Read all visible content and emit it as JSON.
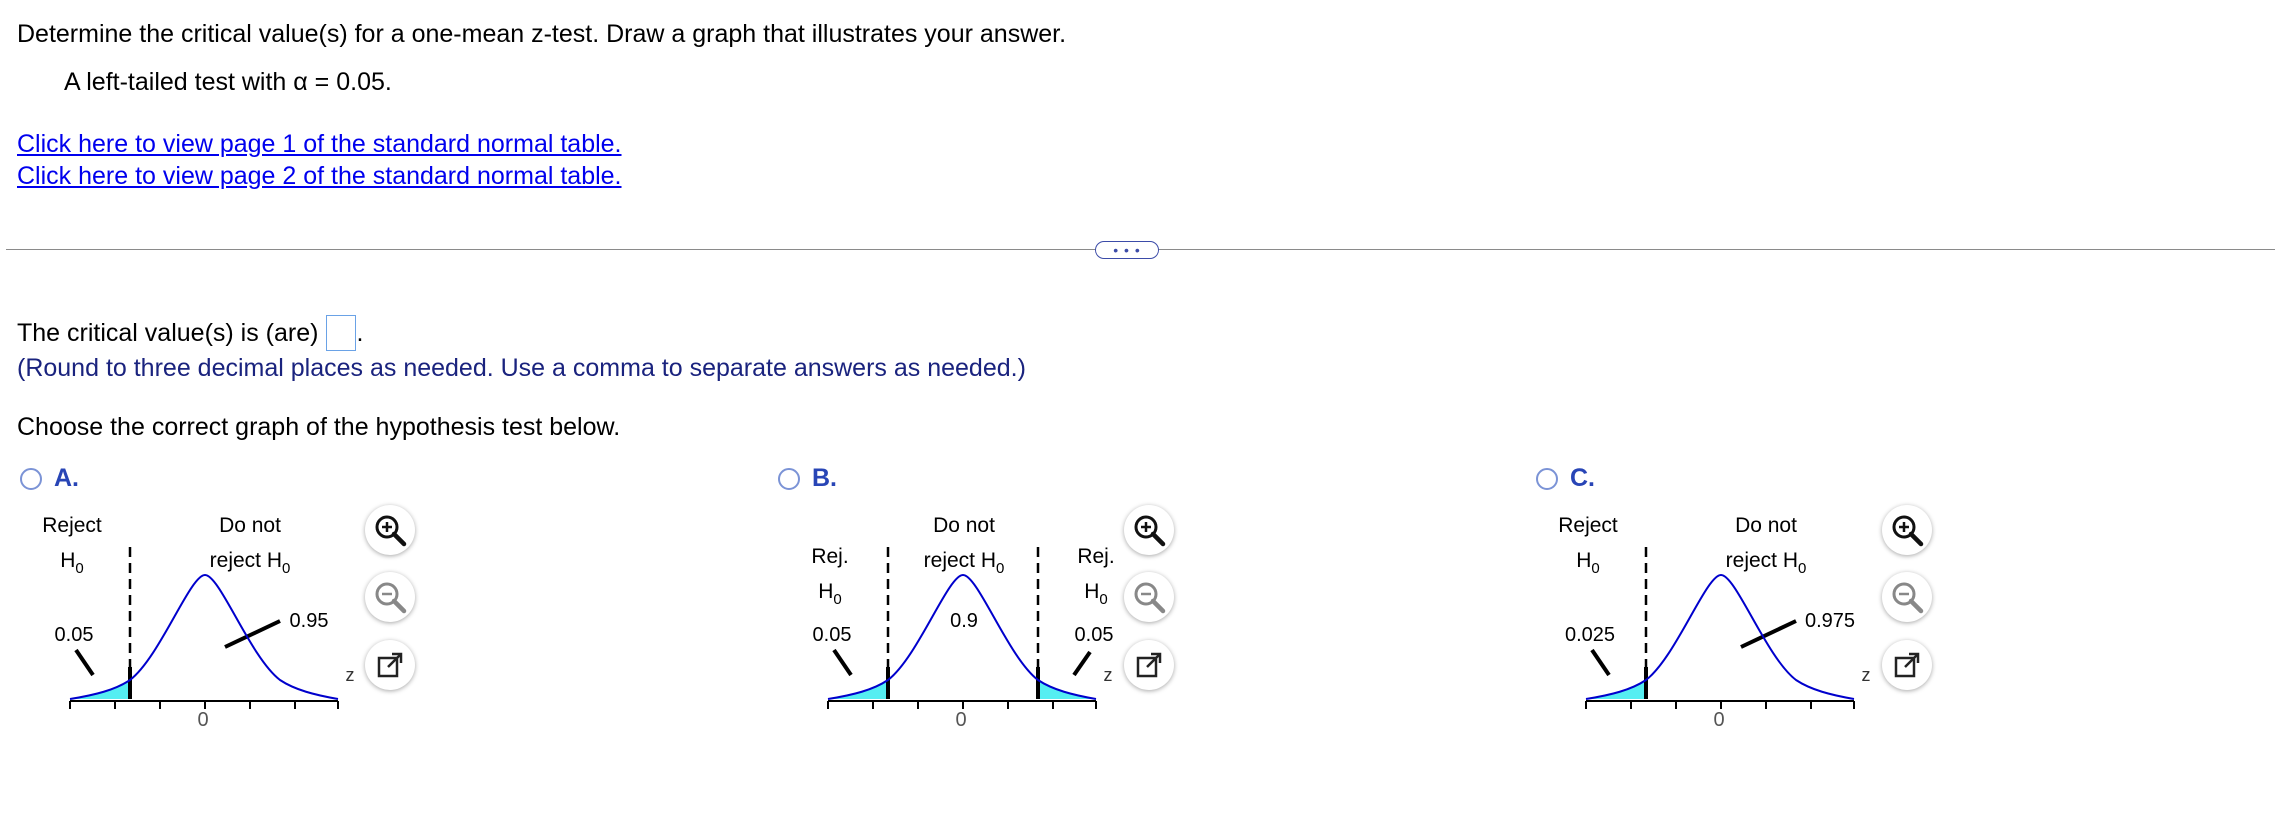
{
  "question": {
    "prompt": "Determine the critical value(s) for a one-mean z-test. Draw a graph that illustrates your answer.",
    "condition_prefix": "A left-tailed test with ",
    "condition_alpha": "α = 0.05."
  },
  "links": [
    "Click here to view page 1 of the standard normal table.",
    "Click here to view page 2 of the standard normal table."
  ],
  "more_button_label": "• • •",
  "answer": {
    "prompt_before": "The critical value(s) is (are)",
    "prompt_after": ".",
    "value": "",
    "note": "(Round to three decimal places as needed. Use a comma to separate answers as needed.)"
  },
  "choose_label": "Choose the correct graph of the hypothesis test below.",
  "options": [
    {
      "letter": "A.",
      "left_label": [
        "Reject",
        "H",
        "0"
      ],
      "middle_label": [
        "Do not",
        "reject H",
        "0"
      ],
      "tail_left": "0.05",
      "center_value": "0.95",
      "axis_zero": "0",
      "axis_var": "z"
    },
    {
      "letter": "B.",
      "left_label": [
        "Rej.",
        "H",
        "0"
      ],
      "middle_label": [
        "Do not",
        "reject H",
        "0"
      ],
      "right_label": [
        "Rej.",
        "H",
        "0"
      ],
      "tail_left": "0.05",
      "tail_right": "0.05",
      "center_value": "0.9",
      "axis_zero": "0",
      "axis_var": "z"
    },
    {
      "letter": "C.",
      "left_label": [
        "Reject",
        "H",
        "0"
      ],
      "middle_label": [
        "Do not",
        "reject H",
        "0"
      ],
      "tail_left": "0.025",
      "center_value": "0.975",
      "axis_zero": "0",
      "axis_var": "z"
    }
  ],
  "icons": [
    "zoom-in-icon",
    "zoom-out-icon",
    "open-in-new-window-icon"
  ],
  "colors": {
    "link": "#0000ee",
    "note": "#1a237e",
    "option_letter": "#2845b6",
    "curve": "#0000cc",
    "shade": "#55eef2"
  }
}
